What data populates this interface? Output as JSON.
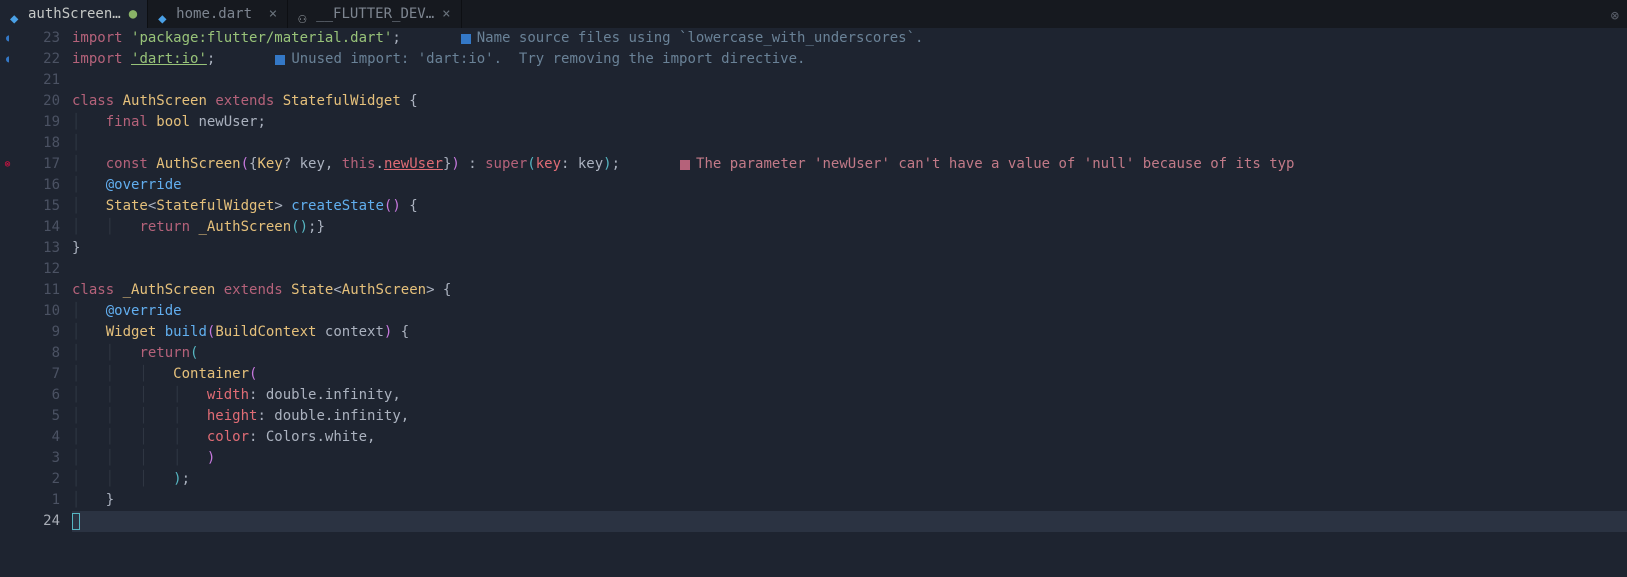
{
  "tabs": [
    {
      "label": "authScreen…",
      "icon": "dart",
      "modified": true,
      "active": true
    },
    {
      "label": "home.dart",
      "icon": "dart",
      "modified": false,
      "active": false
    },
    {
      "label": "__FLUTTER_DEV…",
      "icon": "flutter",
      "modified": false,
      "active": false
    }
  ],
  "lineNumbers": [
    "23",
    "22",
    "21",
    "20",
    "19",
    "18",
    "17",
    "16",
    "15",
    "14",
    "13",
    "12",
    "11",
    "10",
    "9",
    "8",
    "7",
    "6",
    "5",
    "4",
    "3",
    "2",
    "1",
    "24"
  ],
  "currentLine": 24,
  "markers": {
    "0": "info",
    "1": "info",
    "6": "error"
  },
  "code": {
    "l0": {
      "kw": "import",
      "sp": " ",
      "str": "'package:flutter/material.dart'",
      "semi": ";"
    },
    "l1": {
      "kw": "import",
      "sp": " ",
      "str": "'dart:io'",
      "semi": ";"
    },
    "l3": {
      "kw1": "class",
      "cls": " AuthScreen ",
      "kw2": "extends",
      "type": " StatefulWidget ",
      "brace": "{"
    },
    "l4": {
      "indent": "    ",
      "kw": "final",
      "type": " bool ",
      "id": "newUser",
      "semi": ";"
    },
    "l6": {
      "indent": "    ",
      "kw1": "const",
      "cls": " AuthScreen",
      "open": "(",
      "brace": "{",
      "type": "Key",
      "q": "?",
      "id": " key",
      "c": ", ",
      "kw2": "this",
      "dot": ".",
      "prop": "newUser",
      "brace2": "}",
      ")": ")",
      " : ": " : ",
      "kw3": "super",
      "open2": "(",
      "prop2": "key",
      "colon": ": ",
      "id2": "key",
      "close": ")",
      "semi": ";"
    },
    "l7": {
      "indent": "    ",
      "anno": "@override"
    },
    "l8": {
      "indent": "    ",
      "type": "State",
      "lt": "<",
      "type2": "StatefulWidget",
      "gt": "> ",
      "fn": "createState",
      "paren": "()",
      " ": " ",
      "brace": "{"
    },
    "l9": {
      "indent": "        ",
      "kw": "return",
      "sp": " ",
      "cls": "_AuthScreen",
      "paren": "()",
      "semi": ";",
      "brace": "}"
    },
    "l10": {
      "brace": "}"
    },
    "l12": {
      "kw1": "class",
      "cls": " _AuthScreen ",
      "kw2": "extends",
      "type": " State",
      "lt": "<",
      "type2": "AuthScreen",
      "gt": "> ",
      "brace": "{"
    },
    "l13": {
      "indent": "    ",
      "anno": "@override"
    },
    "l14": {
      "indent": "    ",
      "type": "Widget ",
      "fn": "build",
      "open": "(",
      "type2": "BuildContext ",
      "id": "context",
      "close": ")",
      " ": " ",
      "brace": "{"
    },
    "l15": {
      "indent": "        ",
      "kw": "return",
      "paren": "("
    },
    "l16": {
      "indent": "            ",
      "cls": "Container",
      "paren": "("
    },
    "l17": {
      "indent": "                ",
      "prop": "width",
      "colon": ": ",
      "val": "double",
      "dot": ".",
      "val2": "infinity",
      "comma": ","
    },
    "l18": {
      "indent": "                ",
      "prop": "height",
      "colon": ": ",
      "val": "double",
      "dot": ".",
      "val2": "infinity",
      "comma": ","
    },
    "l19": {
      "indent": "                ",
      "prop": "color",
      "colon": ": ",
      "val": "Colors",
      "dot": ".",
      "val2": "white",
      "comma": ","
    },
    "l20": {
      "indent": "                ",
      "paren": ")"
    },
    "l21": {
      "indent": "            ",
      "paren": ")",
      "semi": ";"
    },
    "l22": {
      "indent": "    ",
      "brace": "}"
    },
    "l23": {
      "brace": "}"
    }
  },
  "lints": {
    "l0": "Name source files using `lowercase_with_underscores`.",
    "l1": "Unused import: 'dart:io'.  Try removing the import directive.",
    "l6": "The parameter 'newUser' can't have a value of 'null' because of its typ"
  }
}
